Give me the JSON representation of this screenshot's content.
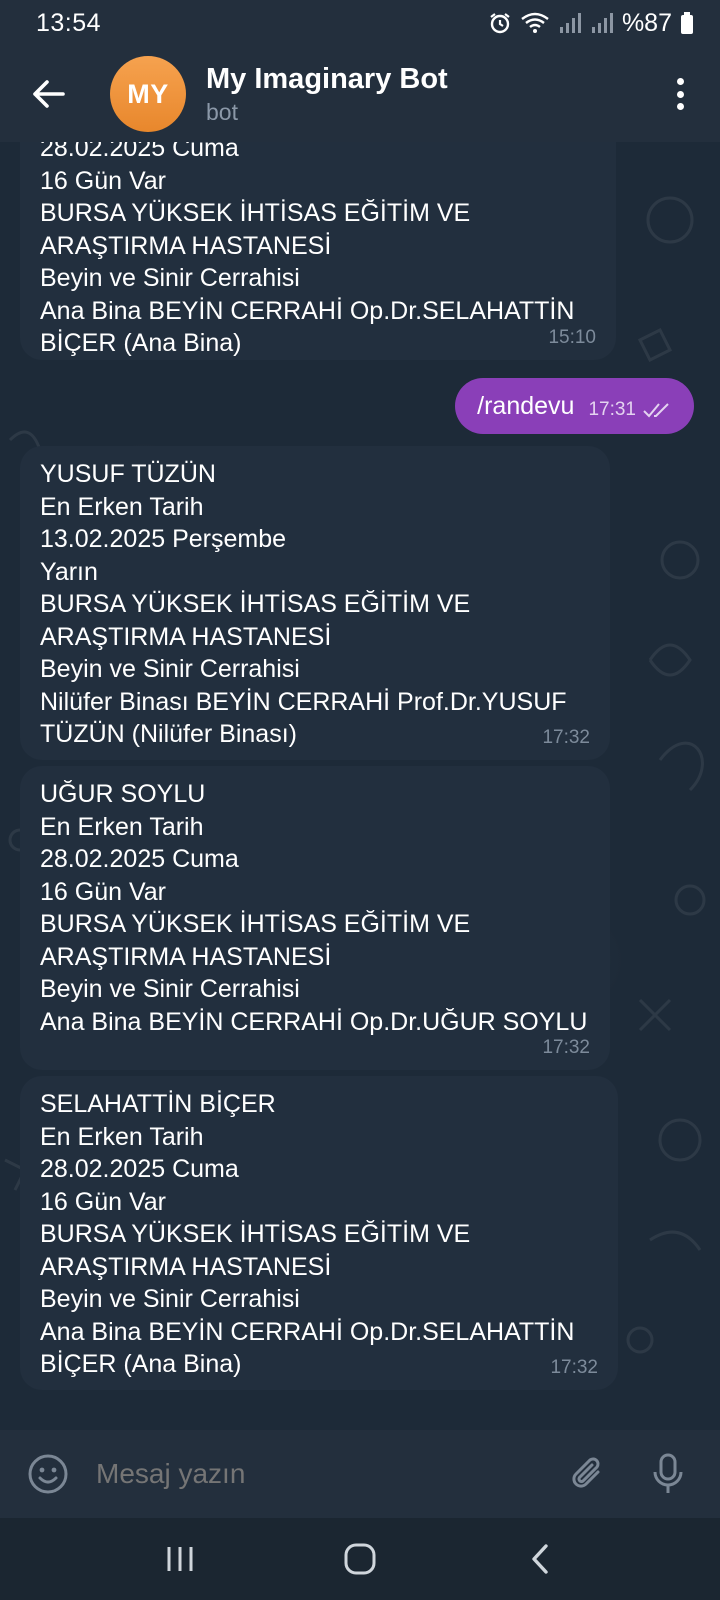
{
  "status_bar": {
    "time": "13:54",
    "battery": "%87"
  },
  "header": {
    "avatar_initials": "MY",
    "title": "My Imaginary Bot",
    "subtitle": "bot"
  },
  "messages": [
    {
      "direction": "in",
      "lines": [
        "28.02.2025 Cuma",
        "16 Gün Var",
        "BURSA YÜKSEK İHTİSAS EĞİTİM VE",
        "ARAŞTIRMA HASTANESİ",
        "Beyin ve Sinir Cerrahisi",
        "Ana Bina BEYİN CERRAHİ Op.Dr.SELAHATTİN",
        "BİÇER (Ana Bina)"
      ],
      "time": "15:10"
    },
    {
      "direction": "out",
      "text": "/randevu",
      "time": "17:31"
    },
    {
      "direction": "in",
      "lines": [
        "YUSUF TÜZÜN",
        "En Erken Tarih",
        "13.02.2025 Perşembe",
        "Yarın",
        "BURSA YÜKSEK İHTİSAS EĞİTİM VE",
        "ARAŞTIRMA HASTANESİ",
        "Beyin ve Sinir Cerrahisi",
        "Nilüfer Binası BEYİN CERRAHİ Prof.Dr.YUSUF",
        "TÜZÜN (Nilüfer Binası)"
      ],
      "time": "17:32"
    },
    {
      "direction": "in",
      "lines": [
        "UĞUR SOYLU",
        "En Erken Tarih",
        "28.02.2025 Cuma",
        "16 Gün Var",
        "BURSA YÜKSEK İHTİSAS EĞİTİM VE",
        "ARAŞTIRMA HASTANESİ",
        "Beyin ve Sinir Cerrahisi",
        "Ana Bina BEYİN CERRAHİ Op.Dr.UĞUR SOYLU"
      ],
      "time": "17:32"
    },
    {
      "direction": "in",
      "lines": [
        "SELAHATTİN BİÇER",
        "En Erken Tarih",
        "28.02.2025 Cuma",
        "16 Gün Var",
        "BURSA YÜKSEK İHTİSAS EĞİTİM VE",
        "ARAŞTIRMA HASTANESİ",
        "Beyin ve Sinir Cerrahisi",
        "Ana Bina BEYİN CERRAHİ Op.Dr.SELAHATTİN",
        "BİÇER (Ana Bina)"
      ],
      "time": "17:32"
    }
  ],
  "composer": {
    "placeholder": "Mesaj yazın"
  },
  "icons": {
    "back": "arrow-left-icon",
    "menu": "more-vertical-icon",
    "emoji": "smiley-icon",
    "attach": "paperclip-icon",
    "mic": "microphone-icon",
    "read_ticks": "double-check-icon",
    "nav_recents": "recents-icon",
    "nav_home": "home-icon",
    "nav_back": "nav-back-icon"
  },
  "colors": {
    "outgoing_bubble": "#8a3fb8",
    "incoming_bubble": "#222f3e",
    "header": "#232f3d",
    "avatar": "#f0943a"
  }
}
